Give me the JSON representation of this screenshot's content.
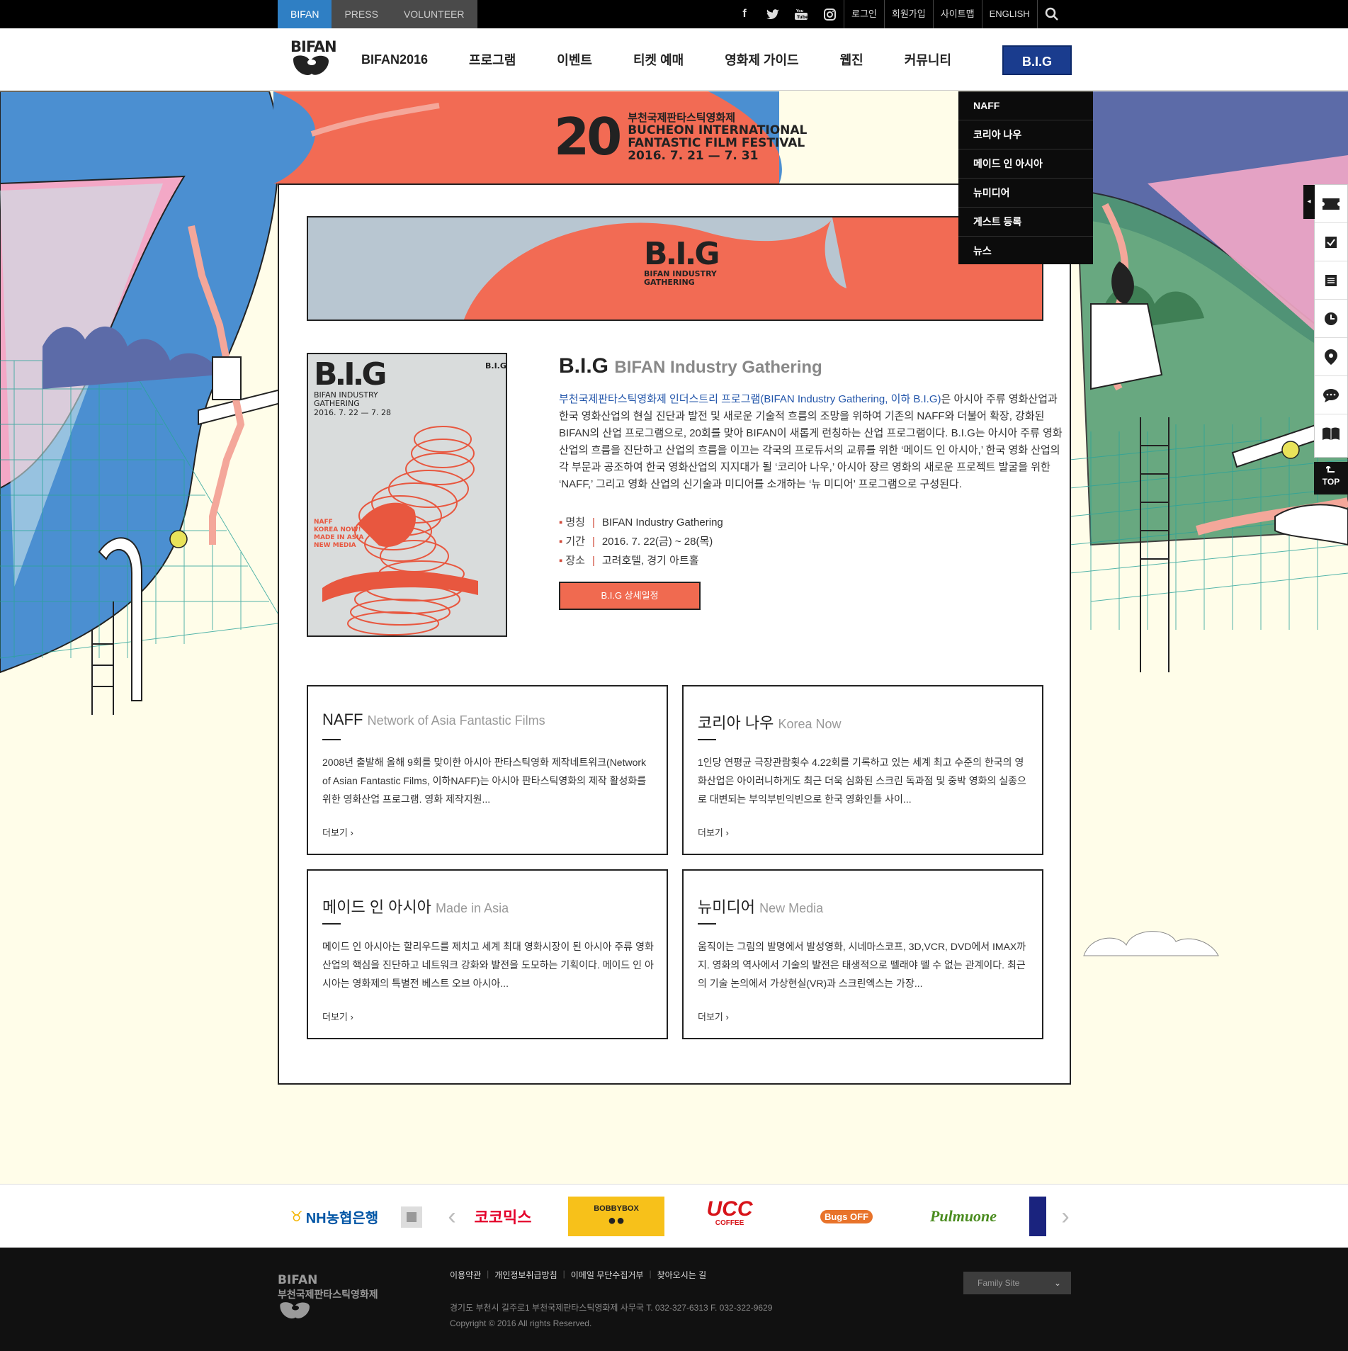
{
  "topbar": {
    "tabs": [
      "BIFAN",
      "PRESS",
      "VOLUNTEER"
    ],
    "links": [
      "로그인",
      "회원가입",
      "사이트맵",
      "ENGLISH"
    ],
    "social": [
      "facebook-icon",
      "twitter-icon",
      "youtube-icon",
      "instagram-icon"
    ]
  },
  "header": {
    "logo": "BIFAN",
    "nav": [
      "BIFAN2016",
      "프로그램",
      "이벤트",
      "티켓 예매",
      "영화제 가이드",
      "웹진",
      "커뮤니티"
    ],
    "active": "B.I.G"
  },
  "hero": {
    "num": "20",
    "ko": "부천국제판타스틱영화제",
    "en1": "BUCHEON INTERNATIONAL",
    "en2": "FANTASTIC FILM FESTIVAL",
    "date": "2016. 7. 21 — 7. 31"
  },
  "dropdown": [
    "NAFF",
    "코리아 나우",
    "메이드 인 아시아",
    "뉴미디어",
    "게스트 등록",
    "뉴스"
  ],
  "banner": {
    "logo": "B.I.G",
    "sub1": "BIFAN INDUSTRY",
    "sub2": "GATHERING"
  },
  "poster": {
    "logo": "B.I.G",
    "t1": "BIFAN INDUSTRY",
    "t2": "GATHERING",
    "date": "2016. 7. 22 — 7. 28",
    "list": [
      "NAFF",
      "KOREA NOW!",
      "MADE IN ASIA",
      "NEW MEDIA"
    ],
    "mini": "B.I.G"
  },
  "intro": {
    "title": "B.I.G",
    "subtitle": "BIFAN Industry Gathering",
    "hl": "부천국제판타스틱영화제 인더스트리 프로그램(BIFAN Industry Gathering, 이하 B.I.G)",
    "desc": "은 아시아 주류 영화산업과 한국 영화산업의 현실 진단과 발전 및 새로운 기술적 흐름의 조망을 위하여 기존의 NAFF와 더불어 확장, 강화된 BIFAN의 산업 프로그램으로, 20회를 맞아 BIFAN이 새롭게 런칭하는 산업 프로그램이다. B.I.G는 아시아 주류 영화산업의 흐름을 진단하고 산업의 흐름을 이끄는 각국의 프로듀서의 교류를 위한 ‘메이드 인 아시아,’ 한국 영화 산업의 각 부문과 공조하여 한국 영화산업의 지지대가 될 ‘코리아 나우,’ 아시아 장르 영화의 새로운 프로젝트 발굴을 위한 ‘NAFF,’ 그리고 영화 산업의 신기술과 미디어를 소개하는 ‘뉴 미디어’ 프로그램으로 구성된다.",
    "meta": [
      {
        "k": "명칭",
        "v": "BIFAN Industry Gathering"
      },
      {
        "k": "기간",
        "v": "2016. 7. 22(금) ~ 28(목)"
      },
      {
        "k": "장소",
        "v": "고려호텔, 경기 아트홀"
      }
    ],
    "button": "B.I.G 상세일정"
  },
  "cards": [
    {
      "title": "NAFF",
      "en": "Network of Asia Fantastic Films",
      "desc": "2008년 출발해 올해 9회를 맞이한 아시아 판타스틱영화 제작네트워크(Network of Asian Fantastic Films, 이하NAFF)는 아시아 판타스틱영화의 제작 활성화를 위한 영화산업 프로그램. 영화 제작지원...",
      "more": "더보기"
    },
    {
      "title": "코리아 나우",
      "en": "Korea Now",
      "desc": "1인당 연평균 극장관람횟수 4.22회를 기록하고 있는 세계 최고 수준의 한국의 영화산업은 아이러니하게도 최근 더욱 심화된 스크린 독과점 및 중박 영화의 실종으로 대변되는 부익부빈익빈으로 한국 영화인들 사이...",
      "more": "더보기"
    },
    {
      "title": "메이드 인 아시아",
      "en": "Made in Asia",
      "desc": "메이드 인 아시아는 할리우드를 제치고 세계 최대 영화시장이 된 아시아 주류 영화산업의 핵심을 진단하고 네트워크 강화와 발전을 도모하는 기획이다. 메이드 인 아시아는 영화제의 특별전 베스트 오브 아시아...",
      "more": "더보기"
    },
    {
      "title": "뉴미디어",
      "en": "New Media",
      "desc": "움직이는 그림의 발명에서 발성영화, 시네마스코프, 3D,VCR, DVD에서 IMAX까지. 영화의 역사에서 기술의 발전은 태생적으로 뗄래야 뗄 수 없는 관계이다. 최근의 기술 논의에서 가상현실(VR)과 스크린엑스는 가장...",
      "more": "더보기"
    }
  ],
  "quick": {
    "top": "TOP",
    "icons": [
      "ticket-icon",
      "check-icon",
      "list-icon",
      "clock-icon",
      "location-icon",
      "chat-icon",
      "book-icon"
    ]
  },
  "partners": [
    "NH농협은행",
    "코코믹스",
    "BOBBYBOX",
    "UCC",
    "COFFEE",
    "Bugs OFF",
    "Pulmuone"
  ],
  "footer": {
    "logo1": "BIFAN",
    "logo2": "부천국제판타스틱영화제",
    "links": [
      "이용약관",
      "개인정보취급방침",
      "이메일 무단수집거부",
      "찾아오시는 길"
    ],
    "addr": "경기도 부천시 길주로1 부천국제판타스틱영화제 사무국 T. 032-327-6313 F. 032-322-9629",
    "copy": "Copyright © 2016 All rights Reserved.",
    "family": "Family Site"
  }
}
